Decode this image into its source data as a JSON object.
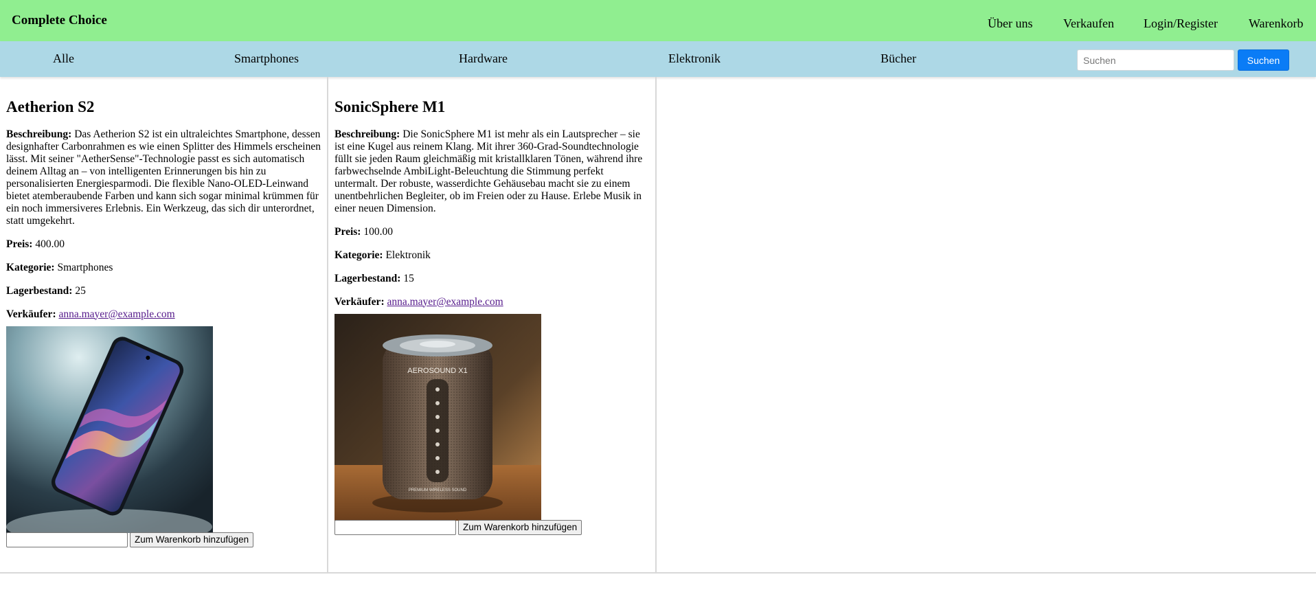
{
  "header": {
    "brand": "Complete Choice",
    "nav": [
      "Über uns",
      "Verkaufen",
      "Login/Register",
      "Warenkorb"
    ],
    "background_color": "#90ee90"
  },
  "categories": {
    "items": [
      "Alle",
      "Smartphones",
      "Hardware",
      "Elektronik",
      "Bücher"
    ],
    "background_color": "#add8e6",
    "search_placeholder": "Suchen",
    "search_value": "",
    "search_button": "Suchen",
    "search_button_color": "#0a7cf6"
  },
  "products": [
    {
      "title": "Aetherion S2",
      "description_label": "Beschreibung:",
      "description": "Das Aetherion S2 ist ein ultraleichtes Smartphone, dessen designhafter Carbonrahmen es wie einen Splitter des Himmels erscheinen lässt. Mit seiner \"AetherSense\"-Technologie passt es sich automatisch deinem Alltag an – von intelligenten Erinnerungen bis hin zu personalisierten Energiesparmodi. Die flexible Nano-OLED-Leinwand bietet atemberaubende Farben und kann sich sogar minimal krümmen für ein noch immersiveres Erlebnis. Ein Werkzeug, das sich dir unterordnet, statt umgekehrt.",
      "price_label": "Preis:",
      "price": "400.00",
      "category_label": "Kategorie:",
      "category": "Smartphones",
      "stock_label": "Lagerbestand:",
      "stock": "25",
      "seller_label": "Verkäufer:",
      "seller": "anna.mayer@example.com",
      "image_icon": "smartphone-image",
      "quantity_value": "",
      "add_button": "Zum Warenkorb hinzufügen"
    },
    {
      "title": "SonicSphere M1",
      "description_label": "Beschreibung:",
      "description": "Die SonicSphere M1 ist mehr als ein Lautsprecher – sie ist eine Kugel aus reinem Klang. Mit ihrer 360-Grad-Soundtechnologie füllt sie jeden Raum gleichmäßig mit kristallklaren Tönen, während ihre farbwechselnde AmbiLight-Beleuchtung die Stimmung perfekt untermalt. Der robuste, wasserdichte Gehäusebau macht sie zu einem unentbehrlichen Begleiter, ob im Freien oder zu Hause. Erlebe Musik in einer neuen Dimension.",
      "price_label": "Preis:",
      "price": "100.00",
      "category_label": "Kategorie:",
      "category": "Elektronik",
      "stock_label": "Lagerbestand:",
      "stock": "15",
      "seller_label": "Verkäufer:",
      "seller": "anna.mayer@example.com",
      "image_icon": "speaker-image",
      "image_text": "AEROSOUND X1",
      "image_subtext": "PREMIUM WIRELESS SOUND",
      "quantity_value": "",
      "add_button": "Zum Warenkorb hinzufügen"
    }
  ]
}
